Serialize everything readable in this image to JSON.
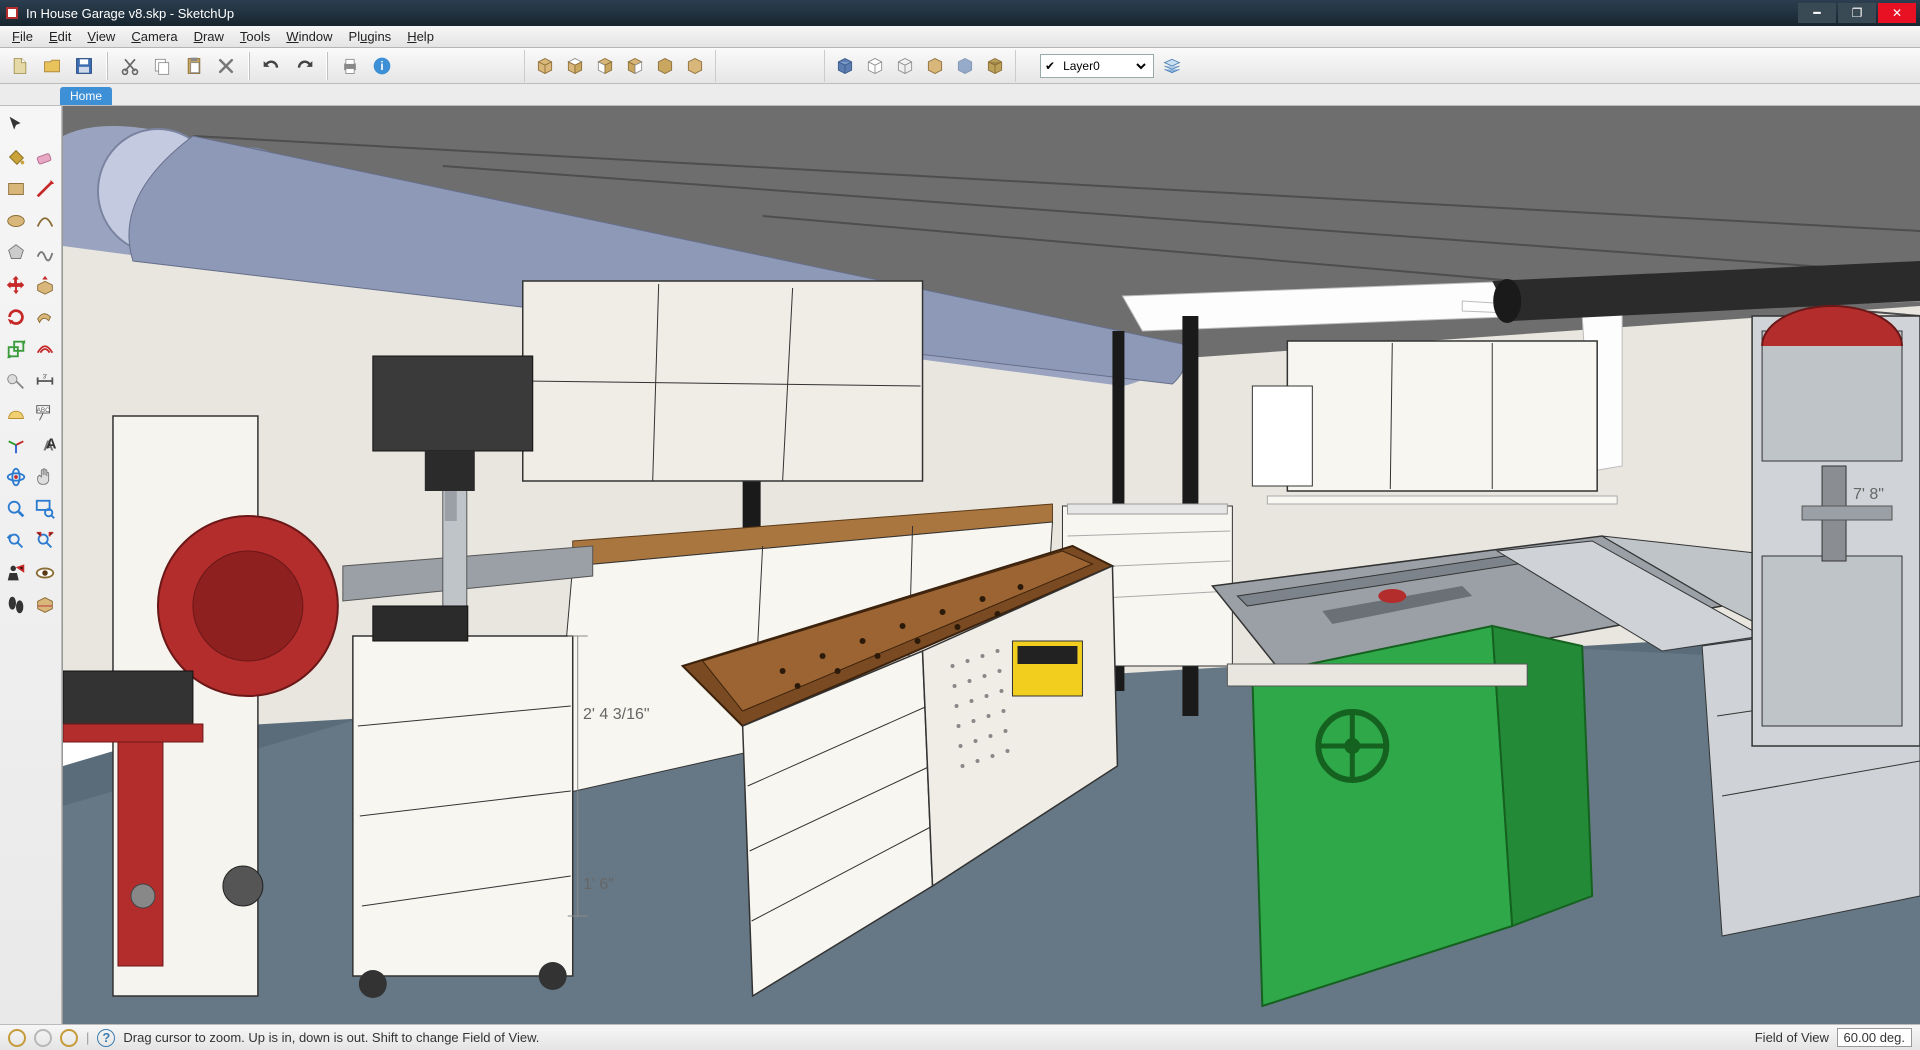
{
  "window": {
    "title": "In House Garage v8.skp - SketchUp"
  },
  "menu": {
    "items": [
      "File",
      "Edit",
      "View",
      "Camera",
      "Draw",
      "Tools",
      "Window",
      "Plugins",
      "Help"
    ]
  },
  "toolbar_main": {
    "new": "new-file-icon",
    "open": "open-file-icon",
    "save": "save-icon",
    "cut": "cut-icon",
    "copy": "copy-icon",
    "paste": "paste-icon",
    "delete": "delete-icon",
    "undo": "undo-icon",
    "redo": "redo-icon",
    "print": "print-icon",
    "info": "model-info-icon"
  },
  "toolbar_views": [
    "iso",
    "top",
    "front",
    "right",
    "back",
    "left"
  ],
  "toolbar_styles": [
    "shaded-textures",
    "shaded",
    "wireframe",
    "hidden-line",
    "xray",
    "monochrome"
  ],
  "layers": {
    "current": "Layer0",
    "options": [
      "Layer0"
    ]
  },
  "scene_tabs": {
    "active": "Home"
  },
  "left_tools": [
    {
      "name": "select-tool",
      "color": "#333"
    },
    {
      "name": "eraser-tool",
      "color": "#e477a8"
    },
    {
      "name": "paint-bucket-tool",
      "color": "#c9a33a"
    },
    {
      "name": "line-tool",
      "color": "#c62828"
    },
    {
      "name": "rectangle-tool",
      "color": "#b58648"
    },
    {
      "name": "circle-tool",
      "color": "#b58648"
    },
    {
      "name": "arc-tool",
      "color": "#b58648"
    },
    {
      "name": "polygon-tool",
      "color": "#8a8a8a"
    },
    {
      "name": "freehand-tool",
      "color": "#8a8a8a"
    },
    {
      "name": "move-tool",
      "color": "#c62828"
    },
    {
      "name": "rotate-tool",
      "color": "#c62828"
    },
    {
      "name": "pushpull-tool",
      "color": "#b58648"
    },
    {
      "name": "scale-tool",
      "color": "#3a9b3a"
    },
    {
      "name": "followme-tool",
      "color": "#b58648"
    },
    {
      "name": "offset-tool",
      "color": "#c62828"
    },
    {
      "name": "tape-measure-tool",
      "color": "#888"
    },
    {
      "name": "protractor-tool",
      "color": "#e0b040"
    },
    {
      "name": "dimension-tool",
      "color": "#c6a84a"
    },
    {
      "name": "text-tool",
      "color": "#555"
    },
    {
      "name": "axes-tool",
      "color": "#2b7"
    },
    {
      "name": "3dtext-tool",
      "color": "#555"
    },
    {
      "name": "orbit-tool",
      "color": "#2b7bd1"
    },
    {
      "name": "pan-tool",
      "color": "#888"
    },
    {
      "name": "zoom-tool",
      "color": "#2b7bd1"
    },
    {
      "name": "zoom-window-tool",
      "color": "#2b7bd1"
    },
    {
      "name": "zoom-extents-tool",
      "color": "#2b7bd1"
    },
    {
      "name": "previous-view-tool",
      "color": "#2b7bd1"
    },
    {
      "name": "look-around-tool",
      "color": "#9c6c3a"
    },
    {
      "name": "position-camera-tool",
      "color": "#333"
    },
    {
      "name": "walk-tool",
      "color": "#333"
    },
    {
      "name": "section-plane-tool",
      "color": "#b58648"
    }
  ],
  "viewport": {
    "dimensions": {
      "height_label": "2' 4 3/16\"",
      "depth_label": "1' 6\"",
      "room_label": "7' 8\""
    }
  },
  "status": {
    "hint": "Drag cursor to zoom.  Up is in, down is out. Shift to change Field of View.",
    "fov_label": "Field of View",
    "fov_value": "60.00 deg."
  }
}
